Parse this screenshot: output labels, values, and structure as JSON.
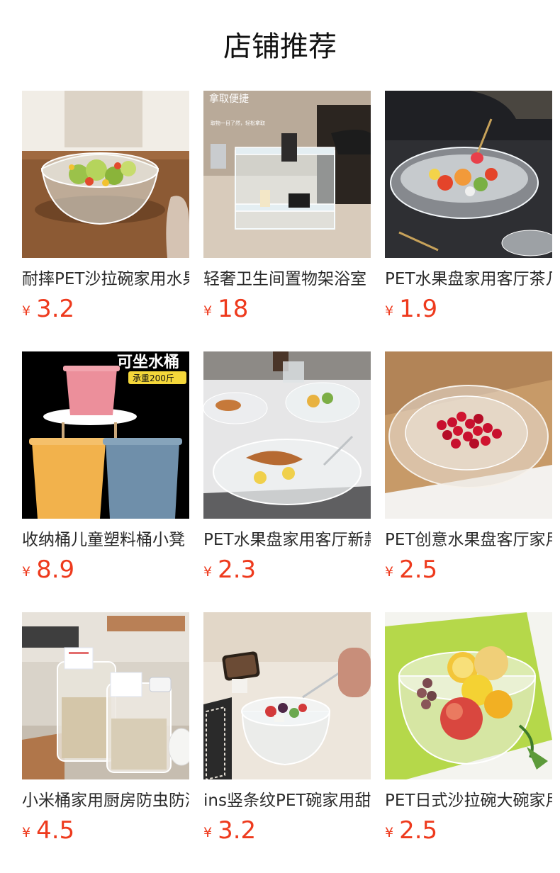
{
  "section": {
    "title": "店铺推荐"
  },
  "currency_symbol": "¥",
  "products": [
    {
      "name": "耐摔PET沙拉碗家用水果",
      "price": "3.2",
      "image": "salad-bowl-photo"
    },
    {
      "name": "轻奢卫生间置物架浴室",
      "price": "18",
      "image": "acrylic-shelf-photo",
      "overlay_text": [
        "拿取便捷",
        "取物一目了然，轻松拿取"
      ]
    },
    {
      "name": "PET水果盘家用客厅茶几",
      "price": "1.9",
      "image": "fruit-bowl-photo"
    },
    {
      "name": "收纳桶儿童塑料桶小凳",
      "price": "8.9",
      "image": "storage-bucket-photo",
      "overlay_text": [
        "可坐水桶",
        "承重200斤"
      ]
    },
    {
      "name": "PET水果盘家用客厅新款",
      "price": "2.3",
      "image": "dining-plates-photo"
    },
    {
      "name": "PET创意水果盘客厅家用",
      "price": "2.5",
      "image": "cherry-plate-photo"
    },
    {
      "name": "小米桶家用厨房防虫防潮",
      "price": "4.5",
      "image": "rice-container-photo"
    },
    {
      "name": "ins竖条纹PET碗家用甜品",
      "price": "3.2",
      "image": "striped-bowl-photo"
    },
    {
      "name": "PET日式沙拉碗大碗家用",
      "price": "2.5",
      "image": "diamond-bowl-photo"
    }
  ]
}
